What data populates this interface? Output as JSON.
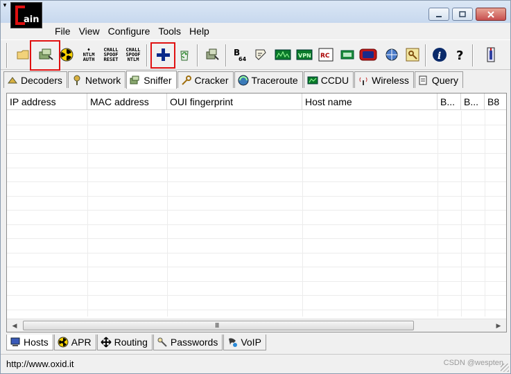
{
  "window": {
    "sysmenu_glyph": "▼",
    "title_controls": [
      "minimize",
      "maximize",
      "close"
    ]
  },
  "menu": {
    "items": [
      {
        "label": "File"
      },
      {
        "label": "View"
      },
      {
        "label": "Configure"
      },
      {
        "label": "Tools"
      },
      {
        "label": "Help"
      }
    ]
  },
  "toolbar": {
    "text_buttons": [
      {
        "line1": "♦",
        "line2": "NTLM",
        "line3": "AUTH"
      },
      {
        "line1": "CHALL",
        "line2": "SPOOF",
        "line3": "RESET"
      },
      {
        "line1": "CHALL",
        "line2": "SPOOF",
        "line3": "NTLM"
      }
    ],
    "highlight_color": "#e01010"
  },
  "top_tabs": [
    {
      "label": "Decoders",
      "icon": "decoders-icon",
      "active": false
    },
    {
      "label": "Network",
      "icon": "network-icon",
      "active": false
    },
    {
      "label": "Sniffer",
      "icon": "sniffer-icon",
      "active": true
    },
    {
      "label": "Cracker",
      "icon": "cracker-key-icon",
      "active": false
    },
    {
      "label": "Traceroute",
      "icon": "traceroute-icon",
      "active": false
    },
    {
      "label": "CCDU",
      "icon": "ccdu-icon",
      "active": false
    },
    {
      "label": "Wireless",
      "icon": "wireless-icon",
      "active": false
    },
    {
      "label": "Query",
      "icon": "query-icon",
      "active": false
    }
  ],
  "table": {
    "columns": [
      "IP address",
      "MAC address",
      "OUI fingerprint",
      "Host name",
      "B...",
      "B...",
      "B8"
    ],
    "rows": [],
    "scroll_grip": "III"
  },
  "bottom_tabs": [
    {
      "label": "Hosts",
      "icon": "hosts-icon",
      "active": true
    },
    {
      "label": "APR",
      "icon": "apr-icon",
      "active": false
    },
    {
      "label": "Routing",
      "icon": "routing-icon",
      "active": false
    },
    {
      "label": "Passwords",
      "icon": "passwords-icon",
      "active": false
    },
    {
      "label": "VoIP",
      "icon": "voip-icon",
      "active": false
    }
  ],
  "status": {
    "url": "http://www.oxid.it",
    "watermark": "CSDN @wespten"
  }
}
